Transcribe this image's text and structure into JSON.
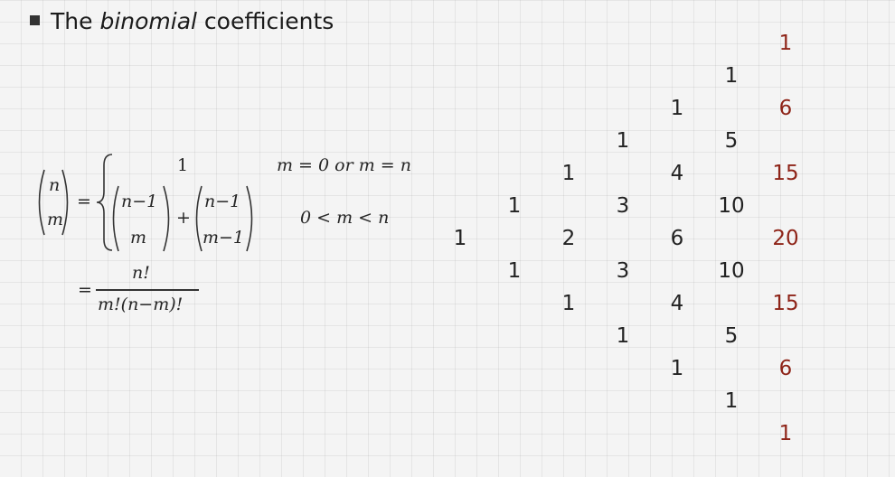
{
  "slide": {
    "title_pre": "The ",
    "title_em": "binomial",
    "title_post": " coefficients"
  },
  "formula": {
    "lhs_top": "n",
    "lhs_bottom": "m",
    "eq": "=",
    "case1_value": "1",
    "case1_condition": "m = 0 or m = n",
    "case2_term1_top": "n−1",
    "case2_term1_bottom": "m",
    "case2_plus": "+",
    "case2_term2_top": "n−1",
    "case2_term2_bottom": "m−1",
    "case2_condition": "0 < m < n",
    "closed_eq": "=",
    "closed_numerator": "n!",
    "closed_denominator": "m!(n−m)!"
  },
  "triangle": {
    "rows": [
      [
        "1"
      ],
      [
        "1",
        "1"
      ],
      [
        "1",
        "2",
        "1"
      ],
      [
        "1",
        "3",
        "3",
        "1"
      ],
      [
        "1",
        "4",
        "6",
        "4",
        "1"
      ],
      [
        "1",
        "5",
        "10",
        "10",
        "5",
        "1"
      ],
      [
        "1",
        "6",
        "15",
        "20",
        "15",
        "6",
        "1"
      ]
    ],
    "highlight_color": "#8e2418"
  }
}
